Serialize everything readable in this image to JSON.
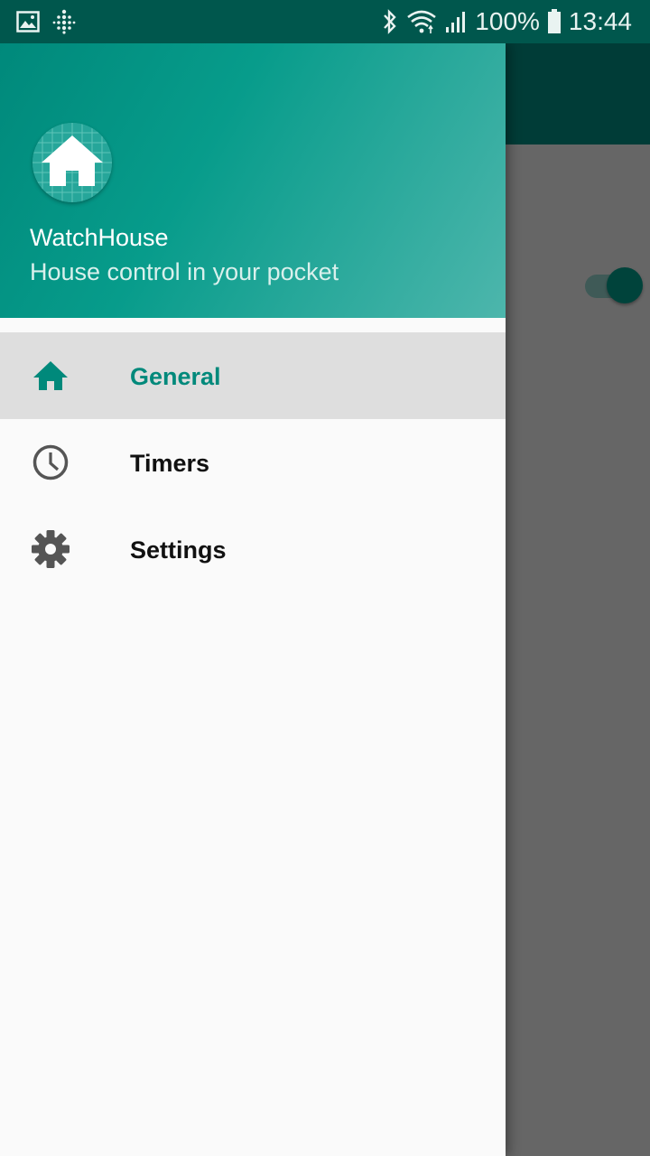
{
  "status_bar": {
    "battery_percent": "100%",
    "time": "13:44",
    "icons": [
      "gallery-icon",
      "fitbit-icon",
      "bluetooth-icon",
      "wifi-icon",
      "signal-icon",
      "battery-icon"
    ]
  },
  "drawer": {
    "header": {
      "app_name": "WatchHouse",
      "tagline": "House control in your pocket",
      "logo": "house-logo"
    },
    "items": [
      {
        "label": "General",
        "icon": "home-icon",
        "active": true
      },
      {
        "label": "Timers",
        "icon": "clock-icon",
        "active": false
      },
      {
        "label": "Settings",
        "icon": "gear-icon",
        "active": false
      }
    ]
  },
  "background_screen": {
    "toggle_on": true
  },
  "colors": {
    "primary": "#00897b",
    "primary_dark": "#00574d",
    "accent": "#00433b",
    "active_item_bg": "#dedede"
  }
}
